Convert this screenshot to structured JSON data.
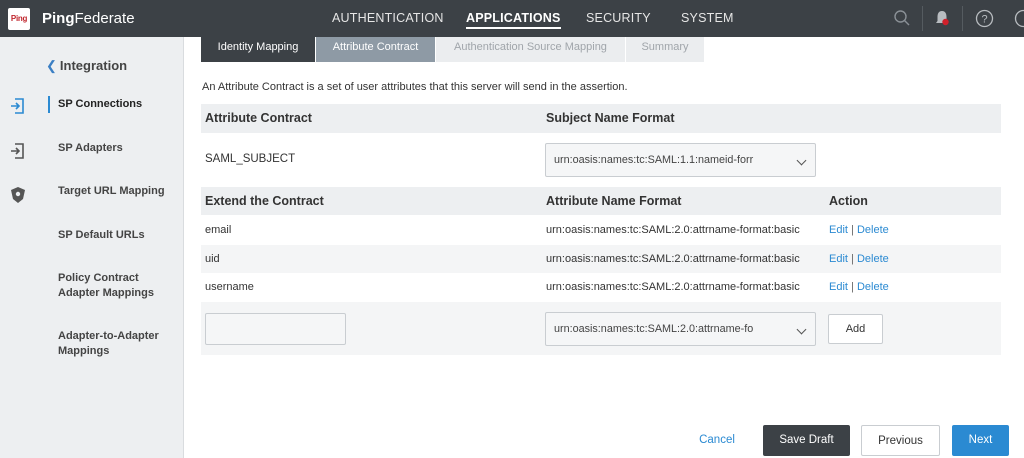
{
  "app": {
    "logo_text": "Ping",
    "brand_part1": "Ping",
    "brand_part2": "Federate"
  },
  "nav": {
    "items": [
      {
        "label": "AUTHENTICATION",
        "active": false
      },
      {
        "label": "APPLICATIONS",
        "active": true
      },
      {
        "label": "SECURITY",
        "active": false
      },
      {
        "label": "SYSTEM",
        "active": false
      }
    ]
  },
  "rail": {
    "icons": [
      "sp-connections-icon",
      "sp-adapters-icon",
      "target-url-icon"
    ]
  },
  "sidebar": {
    "back_label": "Integration",
    "items": [
      {
        "label": "SP Connections",
        "active": true
      },
      {
        "label": "SP Adapters"
      },
      {
        "label": "Target URL Mapping"
      },
      {
        "label": "SP Default URLs"
      },
      {
        "label": "Policy Contract Adapter Mappings"
      },
      {
        "label": "Adapter-to-Adapter Mappings"
      }
    ]
  },
  "tabs": [
    {
      "label": "Identity Mapping",
      "state": "completed"
    },
    {
      "label": "Attribute Contract",
      "state": "current"
    },
    {
      "label": "Authentication Source Mapping",
      "state": "pending"
    },
    {
      "label": "Summary",
      "state": "pending"
    }
  ],
  "description": "An Attribute Contract is a set of user attributes that this server will send in the assertion.",
  "contract": {
    "header_col1": "Attribute Contract",
    "header_col2": "Subject Name Format",
    "subject": "SAML_SUBJECT",
    "subject_format": "urn:oasis:names:tc:SAML:1.1:nameid-forr"
  },
  "extend": {
    "header_col1": "Extend the Contract",
    "header_col2": "Attribute Name Format",
    "header_col3": "Action",
    "rows": [
      {
        "name": "email",
        "format": "urn:oasis:names:tc:SAML:2.0:attrname-format:basic",
        "edit": "Edit",
        "sep": "|",
        "delete": "Delete"
      },
      {
        "name": "uid",
        "format": "urn:oasis:names:tc:SAML:2.0:attrname-format:basic",
        "edit": "Edit",
        "sep": "|",
        "delete": "Delete"
      },
      {
        "name": "username",
        "format": "urn:oasis:names:tc:SAML:2.0:attrname-format:basic",
        "edit": "Edit",
        "sep": "|",
        "delete": "Delete"
      }
    ],
    "new_name_value": "",
    "new_format_value": "urn:oasis:names:tc:SAML:2.0:attrname-fo",
    "add_label": "Add"
  },
  "footer": {
    "cancel": "Cancel",
    "save_draft": "Save Draft",
    "previous": "Previous",
    "next": "Next"
  },
  "colors": {
    "topbar": "#3c4146",
    "accent": "#2b8ad2",
    "notification": "#d0202b"
  }
}
